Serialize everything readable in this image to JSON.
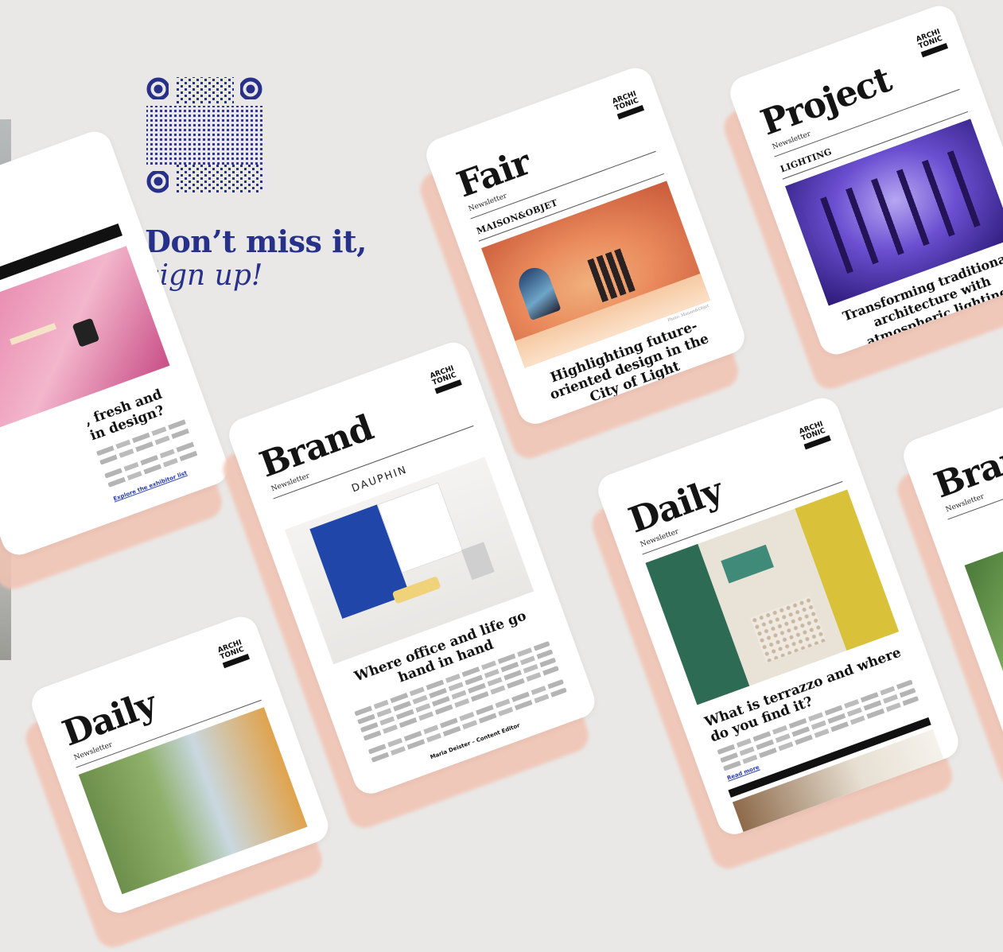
{
  "promo": {
    "headline_bold": "Don’t miss it,",
    "headline_italic": "sign up!",
    "accent_color": "#27318a",
    "shadow_color": "#f2c3b3"
  },
  "cards": {
    "fair": {
      "title": "Fair",
      "subtitle": "Newsletter",
      "logo_line1": "ARCHI",
      "logo_line2": "TONIC",
      "tag": "MAISON&OBJET",
      "headline": "Highlighting future-oriented design in the City of Light",
      "caption": "Photo: Maison&Objet"
    },
    "project": {
      "title": "Project",
      "subtitle": "Newsletter",
      "logo_line1": "ARCHI",
      "logo_line2": "TONIC",
      "tag": "LIGHTING",
      "headline": "Transforming traditional architecture with atmospheric lighting design"
    },
    "brand": {
      "title": "Brand",
      "subtitle": "Newsletter",
      "logo_line1": "ARCHI",
      "logo_line2": "TONIC",
      "brand_name": "DAUPHIN",
      "headline": "Where office and life go hand in hand",
      "author": "Maria Deister – Content Editor"
    },
    "daily_center": {
      "title": "Daily",
      "subtitle": "Newsletter",
      "logo_line1": "ARCHI",
      "logo_line2": "TONIC",
      "headline": "What is terrazzo and where do you find it?",
      "read_more": "Read more"
    },
    "daily_bottom": {
      "title": "Daily",
      "subtitle": "Newsletter",
      "logo_line1": "ARCHI",
      "logo_line2": "TONIC"
    },
    "left_partial": {
      "headline": ", fresh and in design?",
      "link": "Explore the exhibitor list"
    },
    "brand_right": {
      "title": "Brand",
      "subtitle": "Newsletter"
    }
  },
  "icons": [
    "qr-code-icon"
  ]
}
